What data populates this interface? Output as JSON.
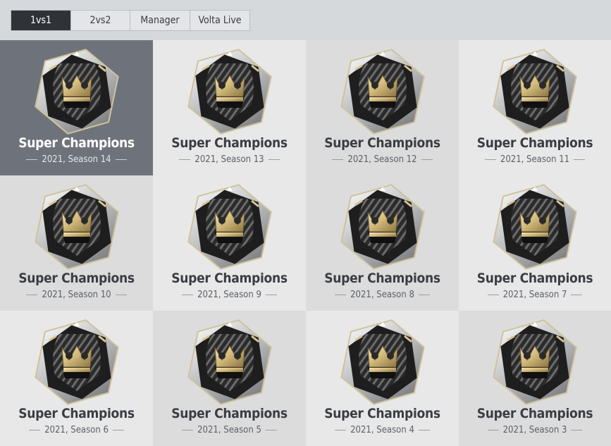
{
  "tabs": [
    {
      "label": "1vs1",
      "active": true
    },
    {
      "label": "2vs2",
      "active": false
    },
    {
      "label": "Manager",
      "active": false
    },
    {
      "label": "Volta Live",
      "active": false
    }
  ],
  "badges": [
    {
      "title": "Super Champions",
      "subtitle": "2021, Season 14",
      "selected": true
    },
    {
      "title": "Super Champions",
      "subtitle": "2021, Season 13"
    },
    {
      "title": "Super Champions",
      "subtitle": "2021, Season 12"
    },
    {
      "title": "Super Champions",
      "subtitle": "2021, Season 11"
    },
    {
      "title": "Super Champions",
      "subtitle": "2021, Season 10"
    },
    {
      "title": "Super Champions",
      "subtitle": "2021, Season 9"
    },
    {
      "title": "Super Champions",
      "subtitle": "2021, Season 8"
    },
    {
      "title": "Super Champions",
      "subtitle": "2021, Season 7"
    },
    {
      "title": "Super Champions",
      "subtitle": "2021, Season 6"
    },
    {
      "title": "Super Champions",
      "subtitle": "2021, Season 5"
    },
    {
      "title": "Super Champions",
      "subtitle": "2021, Season 4"
    },
    {
      "title": "Super Champions",
      "subtitle": "2021, Season 3"
    }
  ],
  "colors": {
    "selected_bg": "#6e737b",
    "active_tab": "#2f3237",
    "gold": "#d9c48e"
  },
  "icon": "crown-emblem-icon"
}
